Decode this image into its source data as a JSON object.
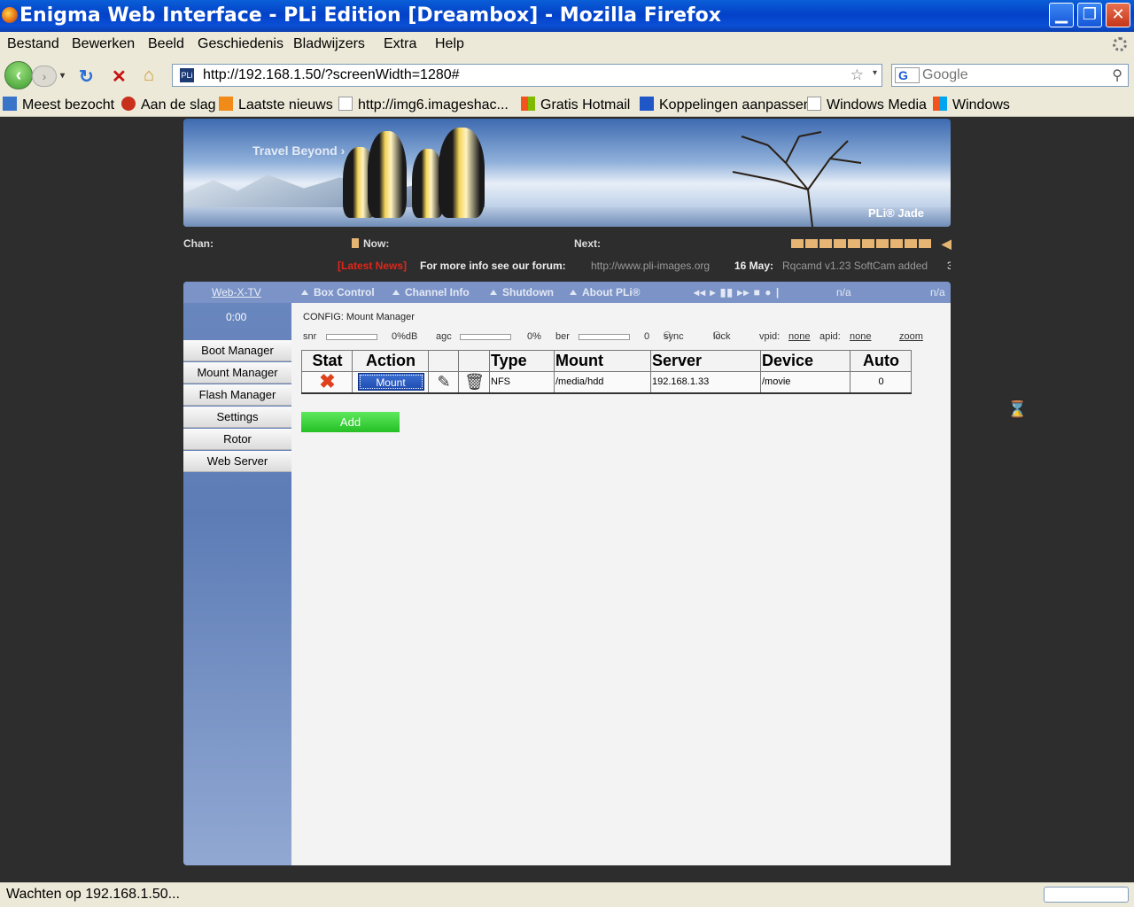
{
  "window": {
    "title": "Enigma Web Interface - PLi Edition [Dreambox] - Mozilla Firefox",
    "min_glyph": "▁",
    "max_glyph": "❐",
    "close_glyph": "✕"
  },
  "menu": [
    "Bestand",
    "Bewerken",
    "Beeld",
    "Geschiedenis",
    "Bladwijzers",
    "Extra",
    "Help"
  ],
  "toolbar": {
    "url": "http://192.168.1.50/?screenWidth=1280#",
    "site_icon_text": "PLi",
    "search_placeholder": "Google",
    "search_engine_letter": "G"
  },
  "bookmarks": [
    "Meest bezocht",
    "Aan de slag",
    "Laatste nieuws",
    "http://img6.imageshac...",
    "Gratis Hotmail",
    "Koppelingen aanpassen",
    "Windows Media",
    "Windows"
  ],
  "banner": {
    "tagline": "Travel Beyond ›",
    "brand": "PLi® Jade"
  },
  "info": {
    "chan_label": "Chan:",
    "now_label": "Now:",
    "next_label": "Next:"
  },
  "news": {
    "tag": "[Latest News]",
    "forum_text": "For more info see our forum:",
    "forum_url": "http://www.pli-images.org",
    "date": "16 May:",
    "item": "Rqcamd v1.23 SoftCam added",
    "tail": "3"
  },
  "topnav": {
    "webx": "Web-X-TV",
    "items": [
      "Box Control",
      "Channel Info",
      "Shutdown",
      "About PLi®"
    ],
    "na1": "n/a",
    "na2": "n/a",
    "controls": "◂◂ ▸ ▮▮ ▸▸ ■ ● |"
  },
  "sidebar": {
    "clock": "0:00",
    "items": [
      "Boot Manager",
      "Mount Manager",
      "Flash Manager",
      "Settings",
      "Rotor",
      "Web Server"
    ]
  },
  "main": {
    "breadcrumb": "CONFIG: Mount Manager",
    "status": {
      "snr_label": "snr",
      "snr_value": "0%dB",
      "agc_label": "agc",
      "agc_value": "0%",
      "ber_label": "ber",
      "ber_value": "0",
      "sync_label": "sync",
      "lock_label": "lock",
      "vpid_label": "vpid:",
      "vpid_value": "none",
      "apid_label": "apid:",
      "apid_value": "none",
      "zoom_label": "zoom"
    },
    "table": {
      "headers": [
        "Stat",
        "Action",
        "",
        "",
        "Type",
        "Mount",
        "Server",
        "Device",
        "Auto"
      ],
      "rows": [
        {
          "stat_icon": "✖",
          "action": "Mount",
          "type": "NFS",
          "mount": "/media/hdd",
          "server": "192.168.1.33",
          "device": "/movie",
          "auto": "0"
        }
      ]
    },
    "add_label": "Add"
  },
  "statusbar": {
    "text": "Wachten op 192.168.1.50..."
  },
  "colors": {
    "accent": "#7b93c6",
    "news_tag": "#e0261a",
    "add_button": "#3bd33b",
    "background": "#2d2d2d"
  }
}
